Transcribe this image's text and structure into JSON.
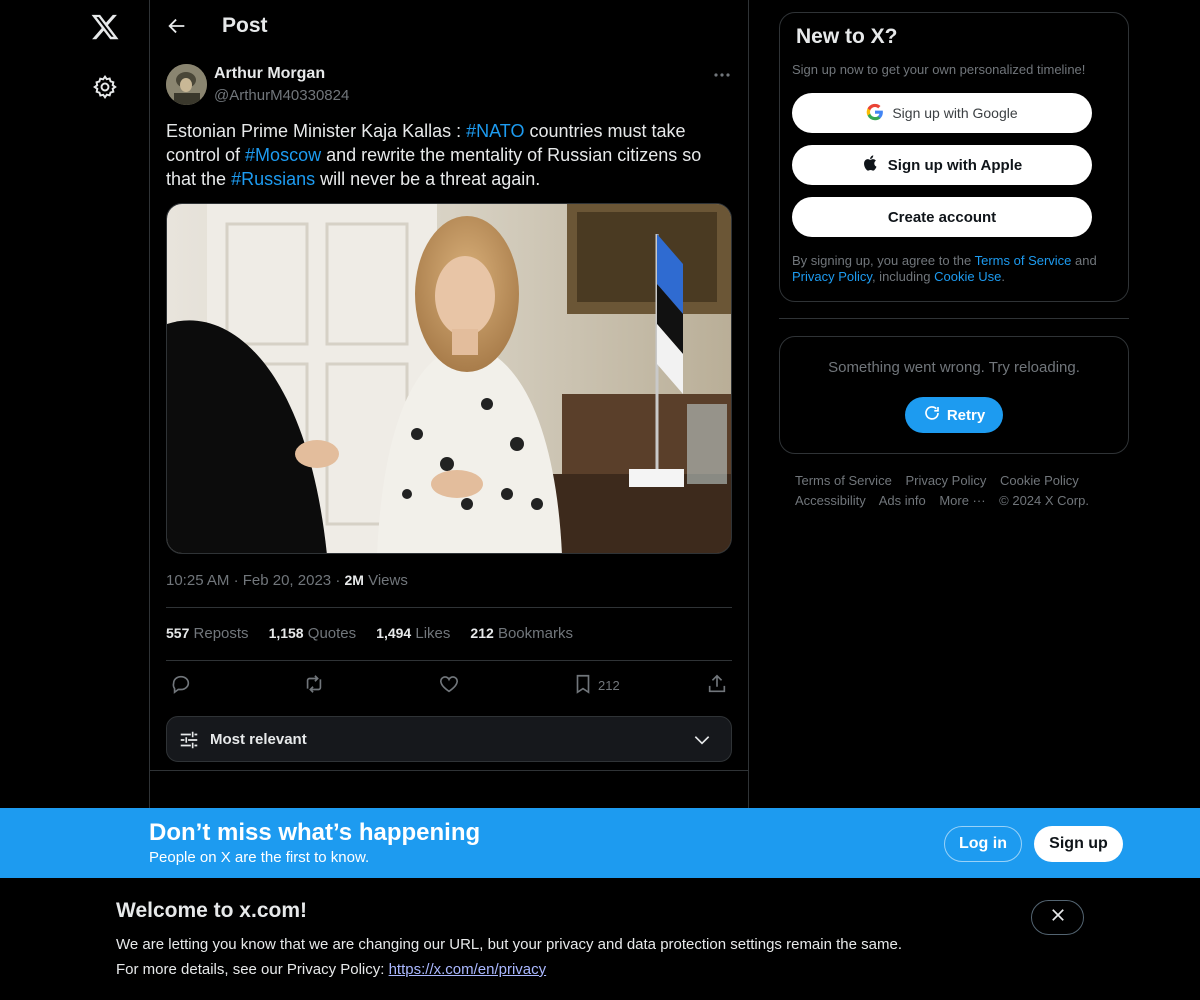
{
  "nav": {
    "logo_icon": "x-logo-icon",
    "settings_icon": "gear-icon"
  },
  "header": {
    "title": "Post"
  },
  "post": {
    "author_name": "Arthur Morgan",
    "author_handle": "@ArthurM40330824",
    "text_parts": [
      {
        "t": "Estonian Prime Minister Kaja Kallas : ",
        "tag": false
      },
      {
        "t": "#NATO",
        "tag": true
      },
      {
        "t": " countries must take control of ",
        "tag": false
      },
      {
        "t": "#Moscow",
        "tag": true
      },
      {
        "t": " and rewrite the mentality of Russian citizens so that the ",
        "tag": false
      },
      {
        "t": "#Russians",
        "tag": true
      },
      {
        "t": " will never be a threat again.",
        "tag": false
      }
    ],
    "time": "10:25 AM",
    "date": "Feb 20, 2023",
    "views_count": "2M",
    "views_label": "Views",
    "reposts_count": "557",
    "reposts_label": "Reposts",
    "quotes_count": "1,158",
    "quotes_label": "Quotes",
    "likes_count": "1,494",
    "likes_label": "Likes",
    "bookmarks_count": "212",
    "bookmarks_label": "Bookmarks",
    "bookmark_action_count": "212"
  },
  "sort": {
    "label": "Most relevant"
  },
  "signup_card": {
    "title": "New to X?",
    "subtitle": "Sign up now to get your own personalized timeline!",
    "google_label": "Sign up with Google",
    "apple_label": "Sign up with Apple",
    "create_label": "Create account",
    "legal_prefix": "By signing up, you agree to the ",
    "terms": "Terms of Service",
    "and": " and",
    "privacy": "Privacy Policy",
    "including": ", including ",
    "cookie": "Cookie Use",
    "period": "."
  },
  "error_card": {
    "message": "Something went wrong. Try reloading.",
    "retry_label": "Retry"
  },
  "footer": {
    "links_row1": [
      "Terms of Service",
      "Privacy Policy",
      "Cookie Policy"
    ],
    "links_row2": [
      "Accessibility",
      "Ads info",
      "More ···",
      "© 2024 X Corp."
    ]
  },
  "banner": {
    "title": "Don’t miss what’s happening",
    "subtitle": "People on X are the first to know.",
    "login_label": "Log in",
    "signup_label": "Sign up"
  },
  "notice": {
    "title": "Welcome to x.com!",
    "line1": "We are letting you know that we are changing our URL, but your privacy and data protection settings remain the same.",
    "line2_prefix": "For more details, see our Privacy Policy: ",
    "link": "https://x.com/en/privacy"
  },
  "colors": {
    "accent": "#1d9bf0",
    "background": "#000000",
    "border": "#2f3336",
    "muted": "#71767b"
  }
}
